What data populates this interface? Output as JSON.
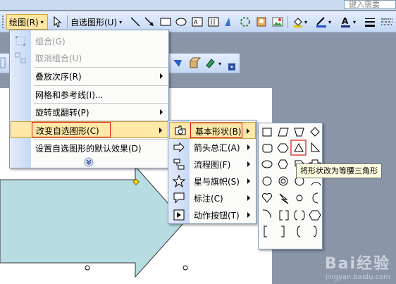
{
  "help_search": {
    "placeholder": "键入需要"
  },
  "toolbar": {
    "draw_label": "绘图(R)",
    "autoshape_label": "自选图形(U)"
  },
  "draw_menu": {
    "items": [
      {
        "label": "组合(G)",
        "disabled": true
      },
      {
        "label": "取消组合(U)",
        "disabled": true
      },
      {
        "label": "叠放次序(R)",
        "submenu": true
      },
      {
        "label": "网格和参考线(I)..."
      },
      {
        "label": "旋转或翻转(P)",
        "submenu": true
      },
      {
        "label": "改变自选图形(C)",
        "submenu": true,
        "active": true
      },
      {
        "label": "设置自选图形的默认效果(D)"
      }
    ],
    "expand_icon": "double-chevron-down-icon"
  },
  "change_shape_menu": {
    "items": [
      {
        "label": "基本形状(B)",
        "active": true
      },
      {
        "label": "箭头总汇(A)"
      },
      {
        "label": "流程图(F)"
      },
      {
        "label": "星与旗帜(S)"
      },
      {
        "label": "标注(C)"
      },
      {
        "label": "动作按钮(T)"
      }
    ]
  },
  "tooltip": "将形状改为等腰三角形",
  "watermark": {
    "title": "Bai经验",
    "url": "jingyan.baidu.com"
  },
  "colors": {
    "highlight": "#ffe8a8",
    "red_box": "#e01010",
    "arrow_fill": "#b7dde2"
  }
}
